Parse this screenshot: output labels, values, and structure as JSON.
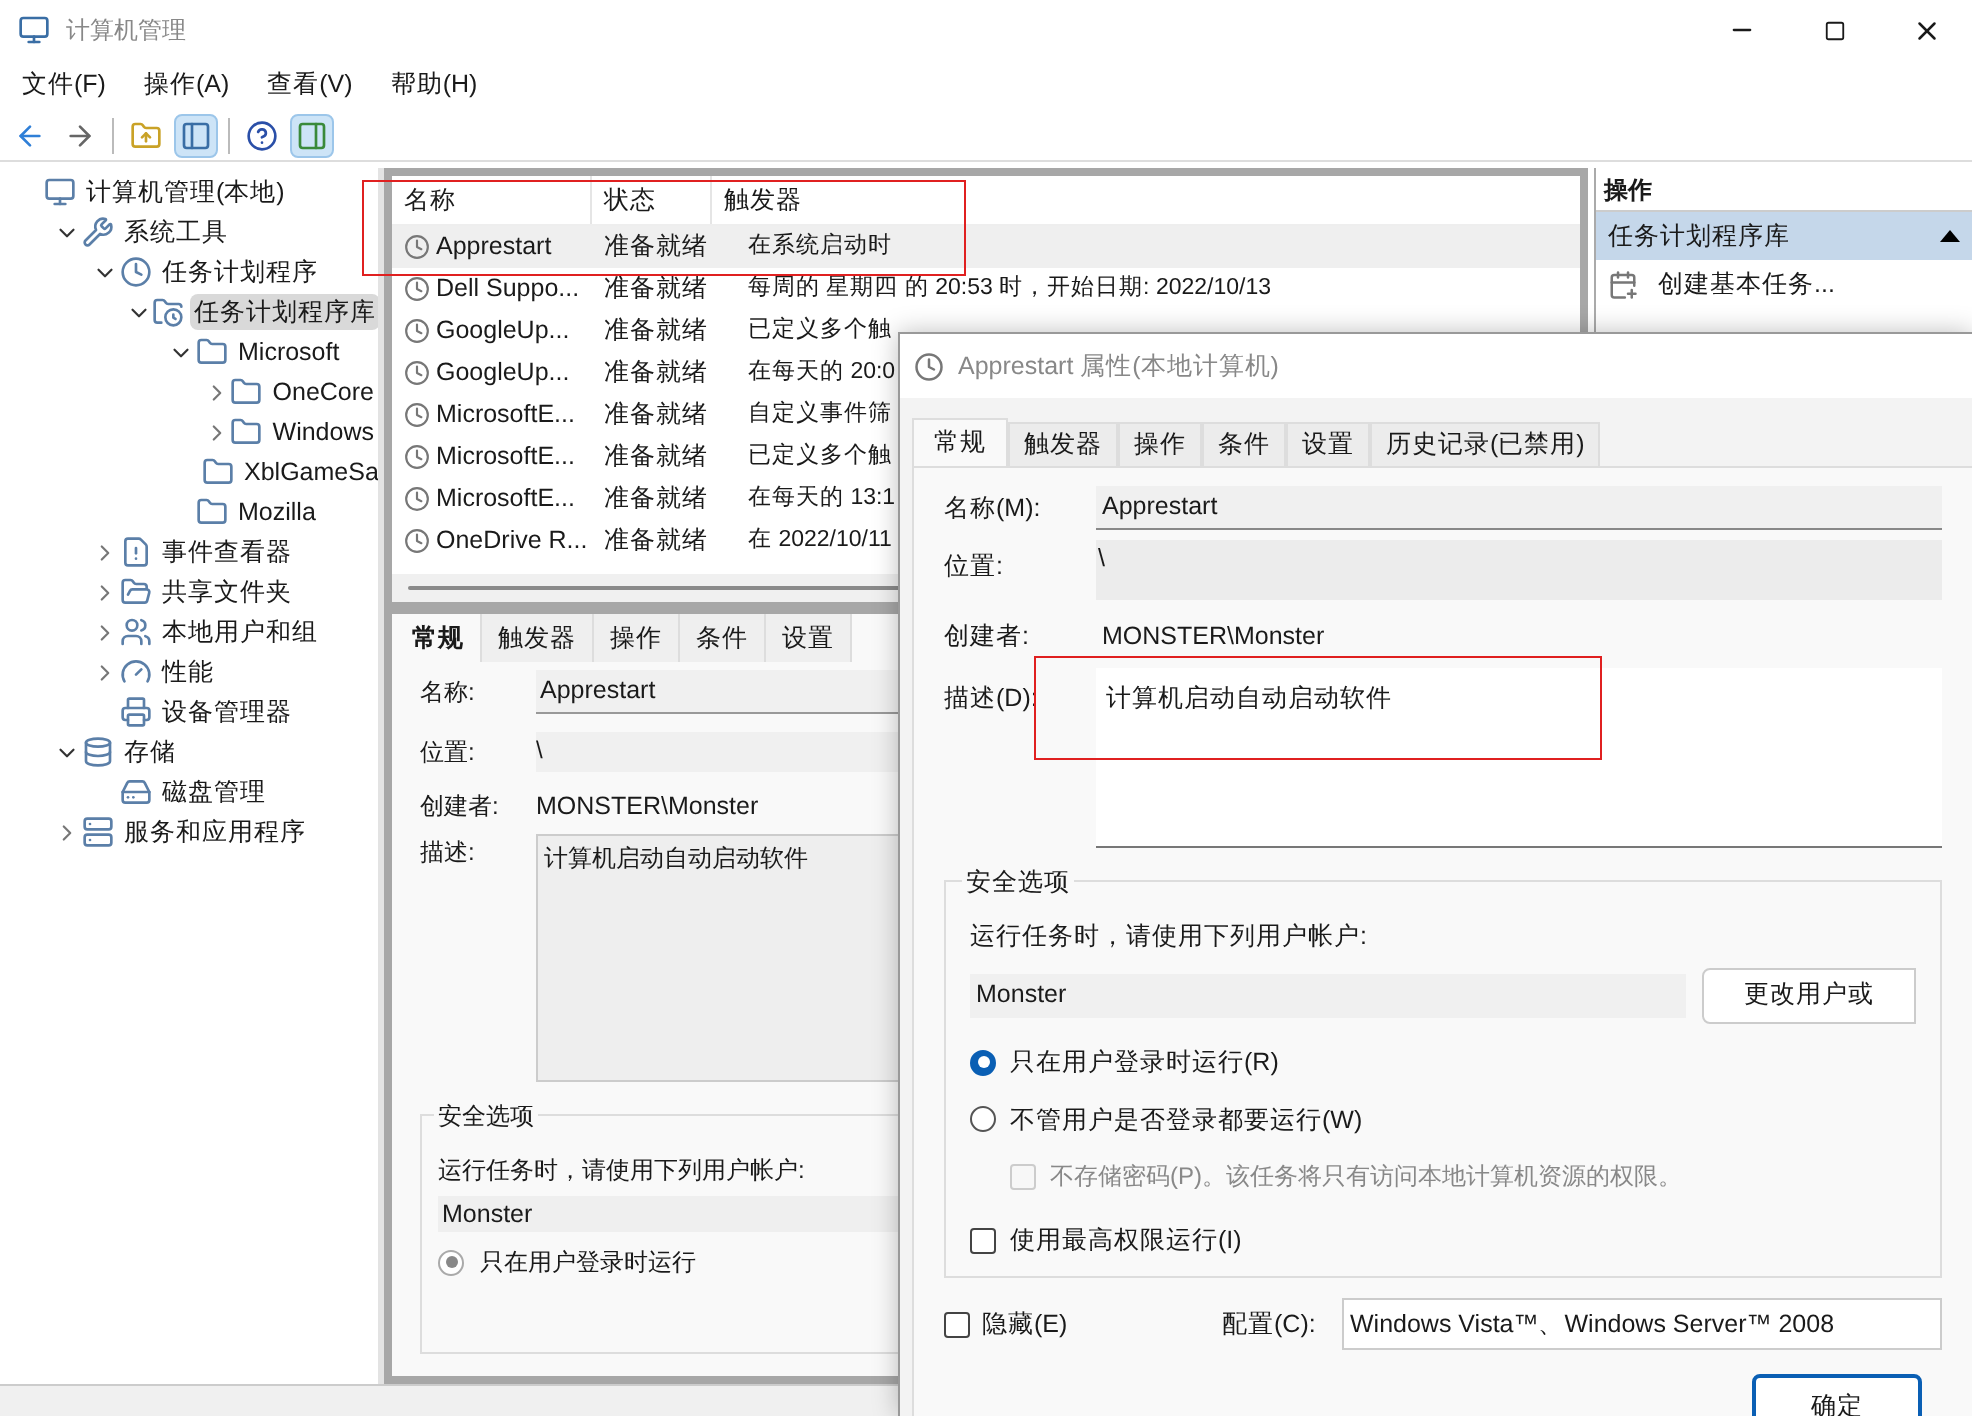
{
  "window": {
    "title": "计算机管理"
  },
  "menu": [
    "文件(F)",
    "操作(A)",
    "查看(V)",
    "帮助(H)"
  ],
  "toolbar": [
    {
      "kind": "back",
      "pressed": false
    },
    {
      "kind": "forward",
      "pressed": false
    },
    {
      "kind": "up",
      "pressed": false
    },
    {
      "kind": "tree",
      "pressed": true
    },
    {
      "kind": "help",
      "pressed": false
    },
    {
      "kind": "actions",
      "pressed": true
    }
  ],
  "tree": [
    {
      "label": "计算机管理(本地)",
      "kind": "computer",
      "selected": false,
      "children": [
        {
          "label": "系统工具",
          "kind": "tools",
          "selected": false,
          "expanded": true,
          "children": [
            {
              "label": "任务计划程序",
              "kind": "clock",
              "selected": false,
              "expanded": true,
              "children": [
                {
                  "label": "任务计划程序库",
                  "kind": "folder-clock",
                  "selected": true,
                  "expanded": true,
                  "children": [
                    {
                      "label": "Microsoft",
                      "kind": "folder",
                      "selected": false,
                      "expanded": true,
                      "children": [
                        {
                          "label": "OneCore",
                          "kind": "folder",
                          "selected": false,
                          "expanded": false
                        },
                        {
                          "label": "Windows",
                          "kind": "folder",
                          "selected": false,
                          "expanded": false
                        },
                        {
                          "label": "XblGameSa",
                          "kind": "folder",
                          "selected": false
                        }
                      ]
                    },
                    {
                      "label": "Mozilla",
                      "kind": "folder",
                      "selected": false
                    }
                  ]
                }
              ]
            },
            {
              "label": "事件查看器",
              "kind": "event",
              "selected": false,
              "expanded": false
            },
            {
              "label": "共享文件夹",
              "kind": "share",
              "selected": false,
              "expanded": false
            },
            {
              "label": "本地用户和组",
              "kind": "users",
              "selected": false,
              "expanded": false
            },
            {
              "label": "性能",
              "kind": "perf",
              "selected": false,
              "expanded": false
            },
            {
              "label": "设备管理器",
              "kind": "device",
              "selected": false
            }
          ]
        },
        {
          "label": "存储",
          "kind": "storage",
          "selected": false,
          "expanded": true,
          "children": [
            {
              "label": "磁盘管理",
              "kind": "disk",
              "selected": false
            }
          ]
        },
        {
          "label": "服务和应用程序",
          "kind": "services",
          "selected": false,
          "expanded": false
        }
      ]
    }
  ],
  "task_list": {
    "columns": [
      "名称",
      "状态",
      "触发器"
    ],
    "rows": [
      {
        "name": "Apprestart",
        "status": "准备就绪",
        "trigger": "在系统启动时",
        "selected": true
      },
      {
        "name": "Dell Suppo...",
        "status": "准备就绪",
        "trigger": "每周的 星期四 的 20:53 时，开始日期: 2022/10/13",
        "selected": false
      },
      {
        "name": "GoogleUp...",
        "status": "准备就绪",
        "trigger": "已定义多个触",
        "selected": false
      },
      {
        "name": "GoogleUp...",
        "status": "准备就绪",
        "trigger": "在每天的 20:0",
        "selected": false
      },
      {
        "name": "MicrosoftE...",
        "status": "准备就绪",
        "trigger": "自定义事件筛",
        "selected": false
      },
      {
        "name": "MicrosoftE...",
        "status": "准备就绪",
        "trigger": "已定义多个触",
        "selected": false
      },
      {
        "name": "MicrosoftE...",
        "status": "准备就绪",
        "trigger": "在每天的 13:1",
        "selected": false
      },
      {
        "name": "OneDrive R...",
        "status": "准备就绪",
        "trigger": "在 2022/10/11",
        "selected": false
      }
    ]
  },
  "details": {
    "tabs": [
      {
        "label": "常规",
        "selected": true
      },
      {
        "label": "触发器",
        "selected": false
      },
      {
        "label": "操作",
        "selected": false
      },
      {
        "label": "条件",
        "selected": false
      },
      {
        "label": "设置",
        "selected": false
      }
    ],
    "name_label": "名称:",
    "name": "Apprestart",
    "location_label": "位置:",
    "location": "\\",
    "author_label": "创建者:",
    "author": "MONSTER\\Monster",
    "description_label": "描述:",
    "description": "计算机启动自动启动软件",
    "security_title": "安全选项",
    "account_prompt": "运行任务时，请使用下列用户帐户:",
    "account": "Monster",
    "radios": [
      {
        "label": "只在用户登录时运行",
        "selected": true
      }
    ]
  },
  "actions_panel": {
    "title": "操作",
    "section": "任务计划程序库",
    "items": [
      "创建基本任务..."
    ]
  },
  "dialog": {
    "title": "Apprestart 属性(本地计算机)",
    "tabs": [
      {
        "label": "常规",
        "selected": true
      },
      {
        "label": "触发器",
        "selected": false
      },
      {
        "label": "操作",
        "selected": false
      },
      {
        "label": "条件",
        "selected": false
      },
      {
        "label": "设置",
        "selected": false
      },
      {
        "label": "历史记录(已禁用)",
        "selected": false
      }
    ],
    "name_label": "名称(M):",
    "name": "Apprestart",
    "location_label": "位置:",
    "location": "\\",
    "author_label": "创建者:",
    "author": "MONSTER\\Monster",
    "description_label": "描述(D):",
    "description": "计算机启动自动启动软件",
    "security_title": "安全选项",
    "account_prompt": "运行任务时，请使用下列用户帐户:",
    "account": "Monster",
    "change_user_button": "更改用户或",
    "radios": [
      {
        "label": "只在用户登录时运行(R)",
        "selected": true
      },
      {
        "label": "不管用户是否登录都要运行(W)",
        "selected": false
      }
    ],
    "no_password": {
      "label": "不存储密码(P)。该任务将只有访问本地计算机资源的权限。",
      "checked": false,
      "disabled": true
    },
    "highest": {
      "label": "使用最高权限运行(I)",
      "checked": false
    },
    "hidden": {
      "label": "隐藏(E)",
      "checked": false
    },
    "config_label": "配置(C):",
    "config": "Windows Vista™、Windows Server™ 2008",
    "ok_button": "确定"
  }
}
